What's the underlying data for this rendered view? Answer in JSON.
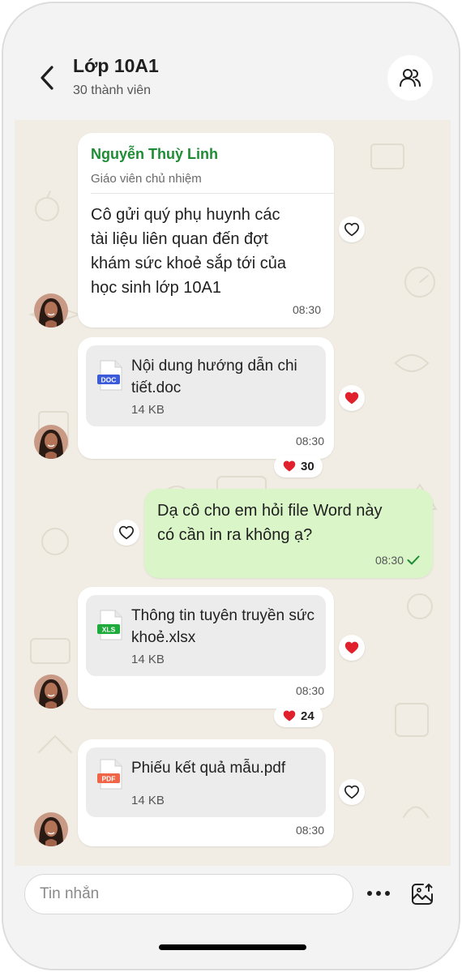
{
  "header": {
    "title": "Lớp 10A1",
    "subtitle": "30 thành viên",
    "back_icon": "chevron-left-icon",
    "members_icon": "users-icon"
  },
  "messages": [
    {
      "sender_name": "Nguyễn Thuỳ Linh",
      "sender_role": "Giáo viên chủ nhiệm",
      "text_lines": [
        "Cô gửi quý phụ huynh các",
        "tài liệu liên quan đến đợt",
        "khám sức khoẻ sắp tới của",
        "học sinh lớp 10A1"
      ],
      "time": "08:30",
      "liked": false
    },
    {
      "file_name": "Nội dung hướng dẫn chi tiết.doc",
      "file_type": "DOC",
      "file_color": "#3b5bdb",
      "file_size": "14 KB",
      "time": "08:30",
      "liked": true,
      "reaction_count": "30"
    },
    {
      "mine": true,
      "text_lines": [
        "Dạ cô cho em hỏi file Word này",
        "có cần in ra không ạ?"
      ],
      "time": "08:30",
      "status_icon": "check-icon",
      "liked": false
    },
    {
      "file_name": "Thông tin tuyên truyền sức khoẻ.xlsx",
      "file_type": "XLS",
      "file_color": "#1faa3c",
      "file_size": "14 KB",
      "time": "08:30",
      "liked": true,
      "reaction_count": "24"
    },
    {
      "file_name": "Phiếu kết quả mẫu.pdf",
      "file_type": "PDF",
      "file_color": "#f06548",
      "file_size": "14 KB",
      "time": "08:30",
      "liked": false
    }
  ],
  "composer": {
    "placeholder": "Tin nhắn",
    "more_icon": "more-dots-icon",
    "media_icon": "image-send-icon"
  },
  "colors": {
    "accent_name": "#1e8c34",
    "mine_bubble": "#daf6c8",
    "chat_bg": "#f1ede4",
    "heart": "#e0202d"
  }
}
